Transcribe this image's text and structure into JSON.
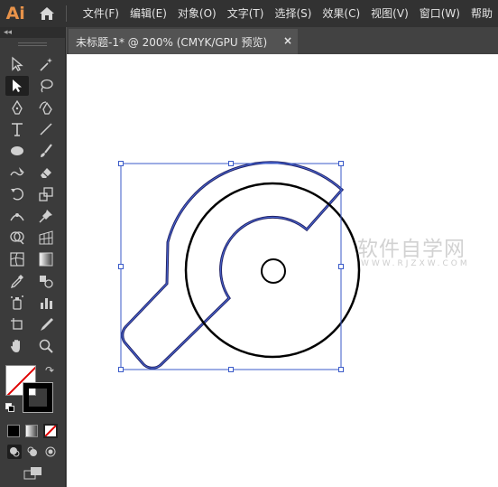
{
  "app": {
    "logo_text": "Ai"
  },
  "menu": {
    "items": [
      {
        "label": "文件(F)"
      },
      {
        "label": "编辑(E)"
      },
      {
        "label": "对象(O)"
      },
      {
        "label": "文字(T)"
      },
      {
        "label": "选择(S)"
      },
      {
        "label": "效果(C)"
      },
      {
        "label": "视图(V)"
      },
      {
        "label": "窗口(W)"
      },
      {
        "label": "帮助"
      }
    ]
  },
  "toolpanel": {
    "collapse_label": "◂◂"
  },
  "document_tab": {
    "title": "未标题-1* @ 200% (CMYK/GPU 预览)",
    "close_label": "×"
  },
  "watermark": {
    "text": "软件自学网",
    "subtext": "WWW.RJZXW.COM"
  },
  "colors": {
    "selection_blue": "#3a5ac8",
    "accent_orange": "#e8934a",
    "panel_bg": "#3b3b3b",
    "menubar_bg": "#323232"
  },
  "tools": [
    {
      "name": "selection-tool-icon"
    },
    {
      "name": "magic-wand-tool-icon"
    },
    {
      "name": "direct-selection-tool-icon"
    },
    {
      "name": "lasso-tool-icon"
    },
    {
      "name": "pen-tool-icon"
    },
    {
      "name": "curvature-tool-icon"
    },
    {
      "name": "type-tool-icon"
    },
    {
      "name": "line-segment-tool-icon"
    },
    {
      "name": "ellipse-tool-icon"
    },
    {
      "name": "paintbrush-tool-icon"
    },
    {
      "name": "shaper-tool-icon"
    },
    {
      "name": "eraser-tool-icon"
    },
    {
      "name": "rotate-tool-icon"
    },
    {
      "name": "scale-tool-icon"
    },
    {
      "name": "width-tool-icon"
    },
    {
      "name": "puppet-warp-tool-icon"
    },
    {
      "name": "shape-builder-tool-icon"
    },
    {
      "name": "perspective-grid-tool-icon"
    },
    {
      "name": "mesh-tool-icon"
    },
    {
      "name": "gradient-tool-icon"
    },
    {
      "name": "eyedropper-tool-icon"
    },
    {
      "name": "blend-tool-icon"
    },
    {
      "name": "symbol-sprayer-tool-icon"
    },
    {
      "name": "column-graph-tool-icon"
    },
    {
      "name": "artboard-tool-icon"
    },
    {
      "name": "slice-tool-icon"
    },
    {
      "name": "hand-tool-icon"
    },
    {
      "name": "zoom-tool-icon"
    }
  ]
}
